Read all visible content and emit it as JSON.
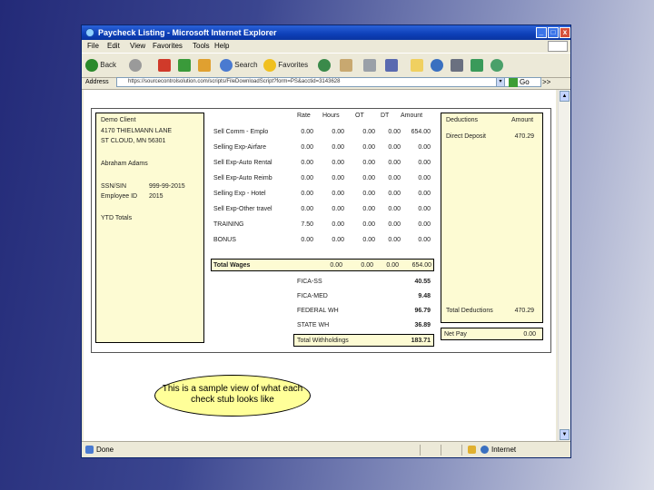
{
  "window": {
    "title": "Paycheck Listing - Microsoft Internet Explorer",
    "min": "_",
    "max": "□",
    "close": "x"
  },
  "menu": [
    "File",
    "Edit",
    "View",
    "Favorites",
    "Tools",
    "Help"
  ],
  "toolbar": {
    "back": "Back",
    "search": "Search",
    "favorites": "Favorites"
  },
  "address": {
    "label": "Address",
    "url": "https://sourcecontrolsolution.com/scripts/FileDownloadScript?form=PS&acctid=3143628",
    "go": "Go",
    "links": ">>"
  },
  "status": {
    "left": "Done",
    "zone": "Internet"
  },
  "stub": {
    "employee": {
      "company": "Demo Client",
      "address1": "4170 THIELMANN LANE",
      "address2": "ST CLOUD, MN 56301",
      "name": "Abraham Adams",
      "ssn_label": "SSN/SIN",
      "ssn": "999-99-2015",
      "id_label": "Employee ID",
      "id": "2015",
      "ytd": "YTD Totals"
    },
    "earn_headers": {
      "rate": "Rate",
      "hours": "Hours",
      "ot": "OT",
      "dt": "DT",
      "amount": "Amount"
    },
    "earnings": [
      {
        "name": "Sell Comm - Emplo",
        "rate": "0.00",
        "hours": "0.00",
        "ot": "0.00",
        "dt": "0.00",
        "amount": "654.00"
      },
      {
        "name": "Selling Exp-Airfare",
        "rate": "0.00",
        "hours": "0.00",
        "ot": "0.00",
        "dt": "0.00",
        "amount": "0.00"
      },
      {
        "name": "Sell Exp-Auto Rental",
        "rate": "0.00",
        "hours": "0.00",
        "ot": "0.00",
        "dt": "0.00",
        "amount": "0.00"
      },
      {
        "name": "Sell Exp-Auto Reimb",
        "rate": "0.00",
        "hours": "0.00",
        "ot": "0.00",
        "dt": "0.00",
        "amount": "0.00"
      },
      {
        "name": "Selling Exp - Hotel",
        "rate": "0.00",
        "hours": "0.00",
        "ot": "0.00",
        "dt": "0.00",
        "amount": "0.00"
      },
      {
        "name": "Sell Exp-Other travel",
        "rate": "0.00",
        "hours": "0.00",
        "ot": "0.00",
        "dt": "0.00",
        "amount": "0.00"
      },
      {
        "name": "TRAINING",
        "rate": "7.50",
        "hours": "0.00",
        "ot": "0.00",
        "dt": "0.00",
        "amount": "0.00"
      },
      {
        "name": "BONUS",
        "rate": "0.00",
        "hours": "0.00",
        "ot": "0.00",
        "dt": "0.00",
        "amount": "0.00"
      }
    ],
    "total_wages": {
      "label": "Total Wages",
      "hours": "0.00",
      "ot": "0.00",
      "dt": "0.00",
      "amount": "654.00"
    },
    "withholdings": [
      {
        "name": "FICA-SS",
        "amount": "40.55"
      },
      {
        "name": "FICA-MED",
        "amount": "9.48"
      },
      {
        "name": "FEDERAL WH",
        "amount": "96.79"
      },
      {
        "name": "STATE WH",
        "amount": "36.89"
      }
    ],
    "total_withholdings": {
      "label": "Total Withholdings",
      "amount": "183.71"
    },
    "deductions": {
      "header": "Deductions",
      "amount_header": "Amount",
      "items": [
        {
          "name": "Direct Deposit",
          "amount": "470.29"
        }
      ],
      "total_label": "Total Deductions",
      "total": "470.29",
      "net_label": "Net Pay",
      "net": "0.00"
    }
  },
  "callout": "This is a sample view of what each check stub looks like"
}
